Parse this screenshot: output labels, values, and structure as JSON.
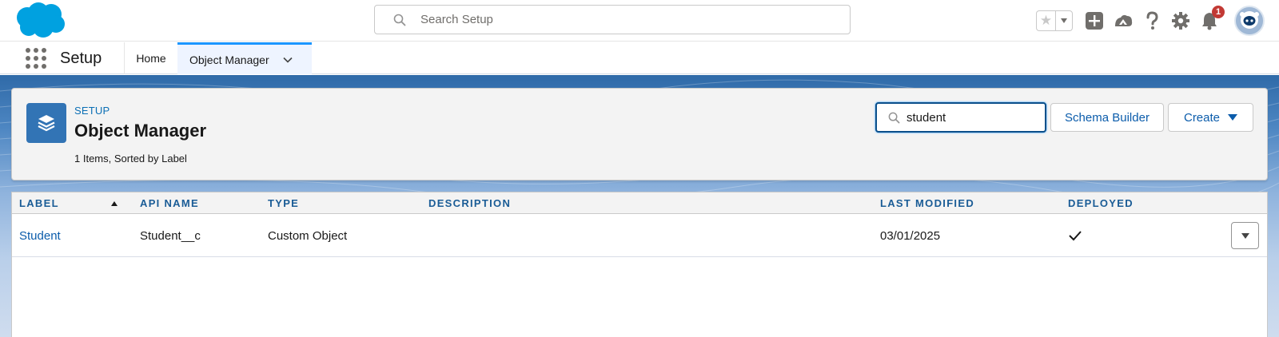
{
  "global_header": {
    "search_placeholder": "Search Setup",
    "notification_count": "1"
  },
  "app_nav": {
    "app_name": "Setup",
    "tabs": [
      {
        "label": "Home"
      },
      {
        "label": "Object Manager"
      }
    ]
  },
  "page_header": {
    "eyebrow": "SETUP",
    "title": "Object Manager",
    "meta": "1 Items, Sorted by Label",
    "quick_find_value": "student",
    "schema_builder_label": "Schema Builder",
    "create_label": "Create"
  },
  "table": {
    "headers": {
      "label": "LABEL",
      "api_name": "API NAME",
      "type": "TYPE",
      "description": "DESCRIPTION",
      "last_modified": "LAST MODIFIED",
      "deployed": "DEPLOYED"
    },
    "rows": [
      {
        "label": "Student",
        "api_name": "Student__c",
        "type": "Custom Object",
        "description": "",
        "last_modified": "03/01/2025",
        "deployed": true
      }
    ]
  },
  "colors": {
    "brand_blue": "#0b5cab",
    "header_text": "#1a5c96",
    "object_icon_bg": "#3274b5",
    "notification_red": "#c23934",
    "logo": "#00a1e0"
  },
  "icons": {
    "logo": "salesforce-cloud-logo",
    "global_search": "search-icon",
    "favorites": "star-icon",
    "global_actions": "plus-icon",
    "trailhead": "trailhead-icon",
    "help": "question-icon",
    "setup": "gear-icon",
    "notifications": "bell-icon",
    "object_manager": "layers-icon"
  }
}
